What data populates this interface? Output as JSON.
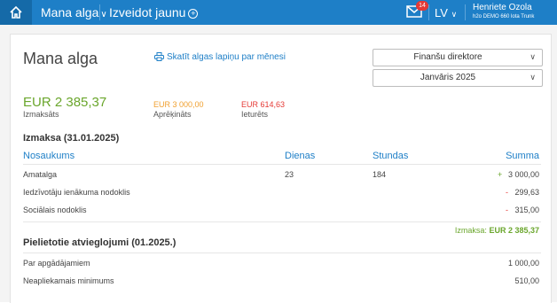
{
  "topbar": {
    "nav_title": "Mana alga",
    "create_new": "Izveidot jaunu",
    "mail_count": "14",
    "language": "LV",
    "user_name": "Henriete Ozola",
    "user_org": "h2o DEMO 660 lota Trunk"
  },
  "page": {
    "title": "Mana alga",
    "print_link": "Skatīt algas lapiņu par mēnesi",
    "position_select": "Finanšu direktore",
    "period_select": "Janvāris 2025"
  },
  "summary": {
    "paid_amount": "EUR 2 385,37",
    "paid_label": "Izmaksāts",
    "calculated_amount": "EUR 3 000,00",
    "calculated_label": "Aprēķināts",
    "withheld_amount": "EUR 614,63",
    "withheld_label": "Ieturēts"
  },
  "payout": {
    "title": "Izmaksa (31.01.2025)",
    "columns": {
      "name": "Nosaukums",
      "days": "Dienas",
      "hours": "Stundas",
      "sum": "Summa"
    },
    "rows": [
      {
        "name": "Amatalga",
        "days": "23",
        "hours": "184",
        "sign": "+",
        "sum": "3 000,00"
      },
      {
        "name": "Iedzīvotāju ienākuma nodoklis",
        "days": "",
        "hours": "",
        "sign": "-",
        "sum": "299,63"
      },
      {
        "name": "Sociālais nodoklis",
        "days": "",
        "hours": "",
        "sign": "-",
        "sum": "315,00"
      }
    ],
    "total_label": "Izmaksa:",
    "total_value": "EUR 2 385,37"
  },
  "reliefs": {
    "title": "Pielietotie atvieglojumi (01.2025.)",
    "rows": [
      {
        "name": "Par apgādājamiem",
        "sum": "1 000,00"
      },
      {
        "name": "Neapliekamais minimums",
        "sum": "510,00"
      }
    ]
  },
  "colors": {
    "brand": "#1e7fc7",
    "positive": "#6aa62c",
    "negative": "#e53935",
    "calculated": "#f0a030"
  }
}
